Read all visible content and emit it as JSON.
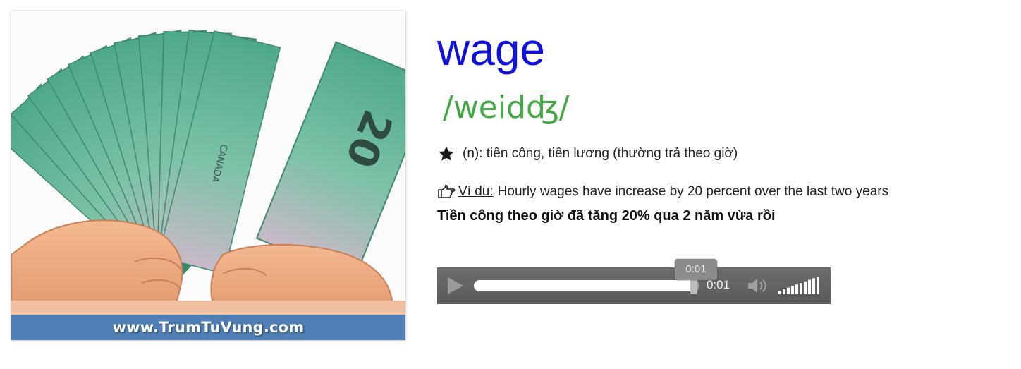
{
  "image_card": {
    "watermark": "www.TrumTuVung.com",
    "banknote_text": "CANADA",
    "banknote_denomination": "20",
    "colors": {
      "banner": "#4f7fb4",
      "note": "#69b99b"
    }
  },
  "entry": {
    "word": "wage",
    "ipa": "/weidʤ/",
    "meaning_icon": "star-icon",
    "meaning": "(n): tiền công, tiền lương (thường trả theo giờ)",
    "example_icon": "pointing-hand-icon",
    "example_label": "Ví du:",
    "example_text": "Hourly wages have increase by 20 percent over the last two years",
    "translation": "Tiền công theo giờ đã tăng 20% qua 2 năm vừa rồi",
    "colors": {
      "word": "#1111dd",
      "ipa": "#44a844"
    }
  },
  "audio_player": {
    "play_icon": "play-icon",
    "tooltip_time": "0:01",
    "current_time": "0:01",
    "progress": 0.985,
    "volume_icon": "speaker-icon",
    "volume_level": 1.0
  }
}
